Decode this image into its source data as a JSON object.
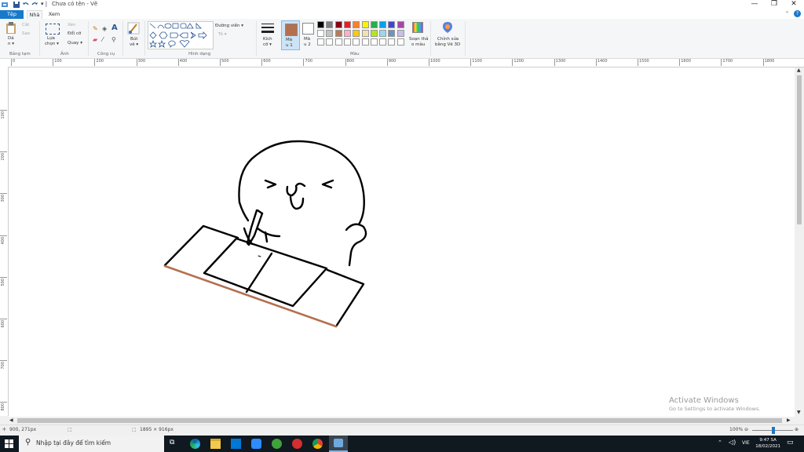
{
  "window": {
    "title": "Chưa có tên - Vẽ",
    "controls": [
      "—",
      "❐",
      "✕"
    ]
  },
  "tabs": [
    "Tệp",
    "Nhà",
    "Xem"
  ],
  "ribbon": {
    "clipboard": {
      "paste": "Dá",
      "paste2": "n ▾",
      "cut": "Cắt",
      "copy": "Sao",
      "group": "Bảng tạm"
    },
    "image": {
      "select": "Lựa",
      "select2": "chọn ▾",
      "crop": "Xén",
      "resize": "Đổi cỡ",
      "rotate": "Quay ▾",
      "group": "Ảnh"
    },
    "tools": {
      "group": "Công cụ"
    },
    "brushes": {
      "label": "Bút",
      "label2": "vẽ ▾"
    },
    "shapes": {
      "outline": "Đường viền ▾",
      "fill": "Tô ▾",
      "group": "Hình dạng"
    },
    "size": {
      "label": "Kích",
      "label2": "cỡ ▾"
    },
    "color1": {
      "label": "Mà",
      "label2": "u 1",
      "value": "#b4704e"
    },
    "color2": {
      "label": "Mà",
      "label2": "u 2",
      "value": "#ffffff"
    },
    "colors_group": "Màu",
    "edit_colors": {
      "label": "Soạn thả",
      "label2": "o màu"
    },
    "paint3d": {
      "label": "Chỉnh sửa",
      "label2": "bằng Vẽ 3D"
    },
    "palette_row1": [
      "#000000",
      "#7f7f7f",
      "#880015",
      "#ed1c24",
      "#ff7f27",
      "#fff200",
      "#22b14c",
      "#00a2e8",
      "#3f48cc",
      "#a349a4"
    ],
    "palette_row2": [
      "#ffffff",
      "#c3c3c3",
      "#b97a57",
      "#ffaec9",
      "#ffc90e",
      "#efe4b0",
      "#b5e61d",
      "#99d9ea",
      "#7092be",
      "#c8bfe7"
    ]
  },
  "ruler": {
    "h_labels": [
      "0",
      "100",
      "200",
      "300",
      "400",
      "500",
      "600",
      "700",
      "800",
      "900",
      "1000",
      "1100",
      "1200",
      "1300",
      "1400",
      "1500",
      "1600",
      "1700",
      "1800"
    ],
    "v_labels": [
      "100",
      "200",
      "300",
      "400",
      "500",
      "600",
      "700",
      "800"
    ]
  },
  "watermark": {
    "line1": "Activate Windows",
    "line2": "Go to Settings to activate Windows."
  },
  "status": {
    "cursor": "900, 271px",
    "canvas_size": "1895 × 916px",
    "zoom": "100%"
  },
  "taskbar": {
    "search_placeholder": "Nhập tại đây để tìm kiếm",
    "time": "9:47 SA",
    "date": "18/02/2021",
    "lang": "VIE"
  }
}
